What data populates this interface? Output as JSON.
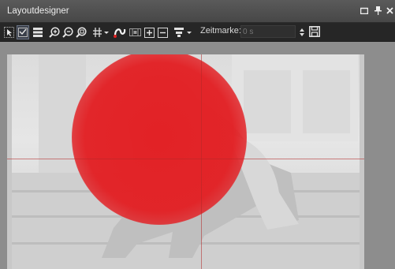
{
  "window": {
    "title": "Layoutdesigner",
    "controls": {
      "maximize_icon": "maximize-icon",
      "pin_icon": "pin-icon",
      "close_icon": "close-icon"
    }
  },
  "toolbar": {
    "tools": [
      "select-icon",
      "check-icon",
      "layers-icon",
      "zoom-in-icon",
      "zoom-out-icon",
      "zoom-fit-icon",
      "grid-icon",
      "path-icon",
      "film-icon",
      "add-frame-icon",
      "remove-frame-icon",
      "align-icon"
    ],
    "timestamp_label": "Zeitmarke:",
    "timestamp_placeholder": "0 s",
    "save_icon": "save-icon"
  },
  "stage": {
    "circle_color": "#e22226"
  }
}
